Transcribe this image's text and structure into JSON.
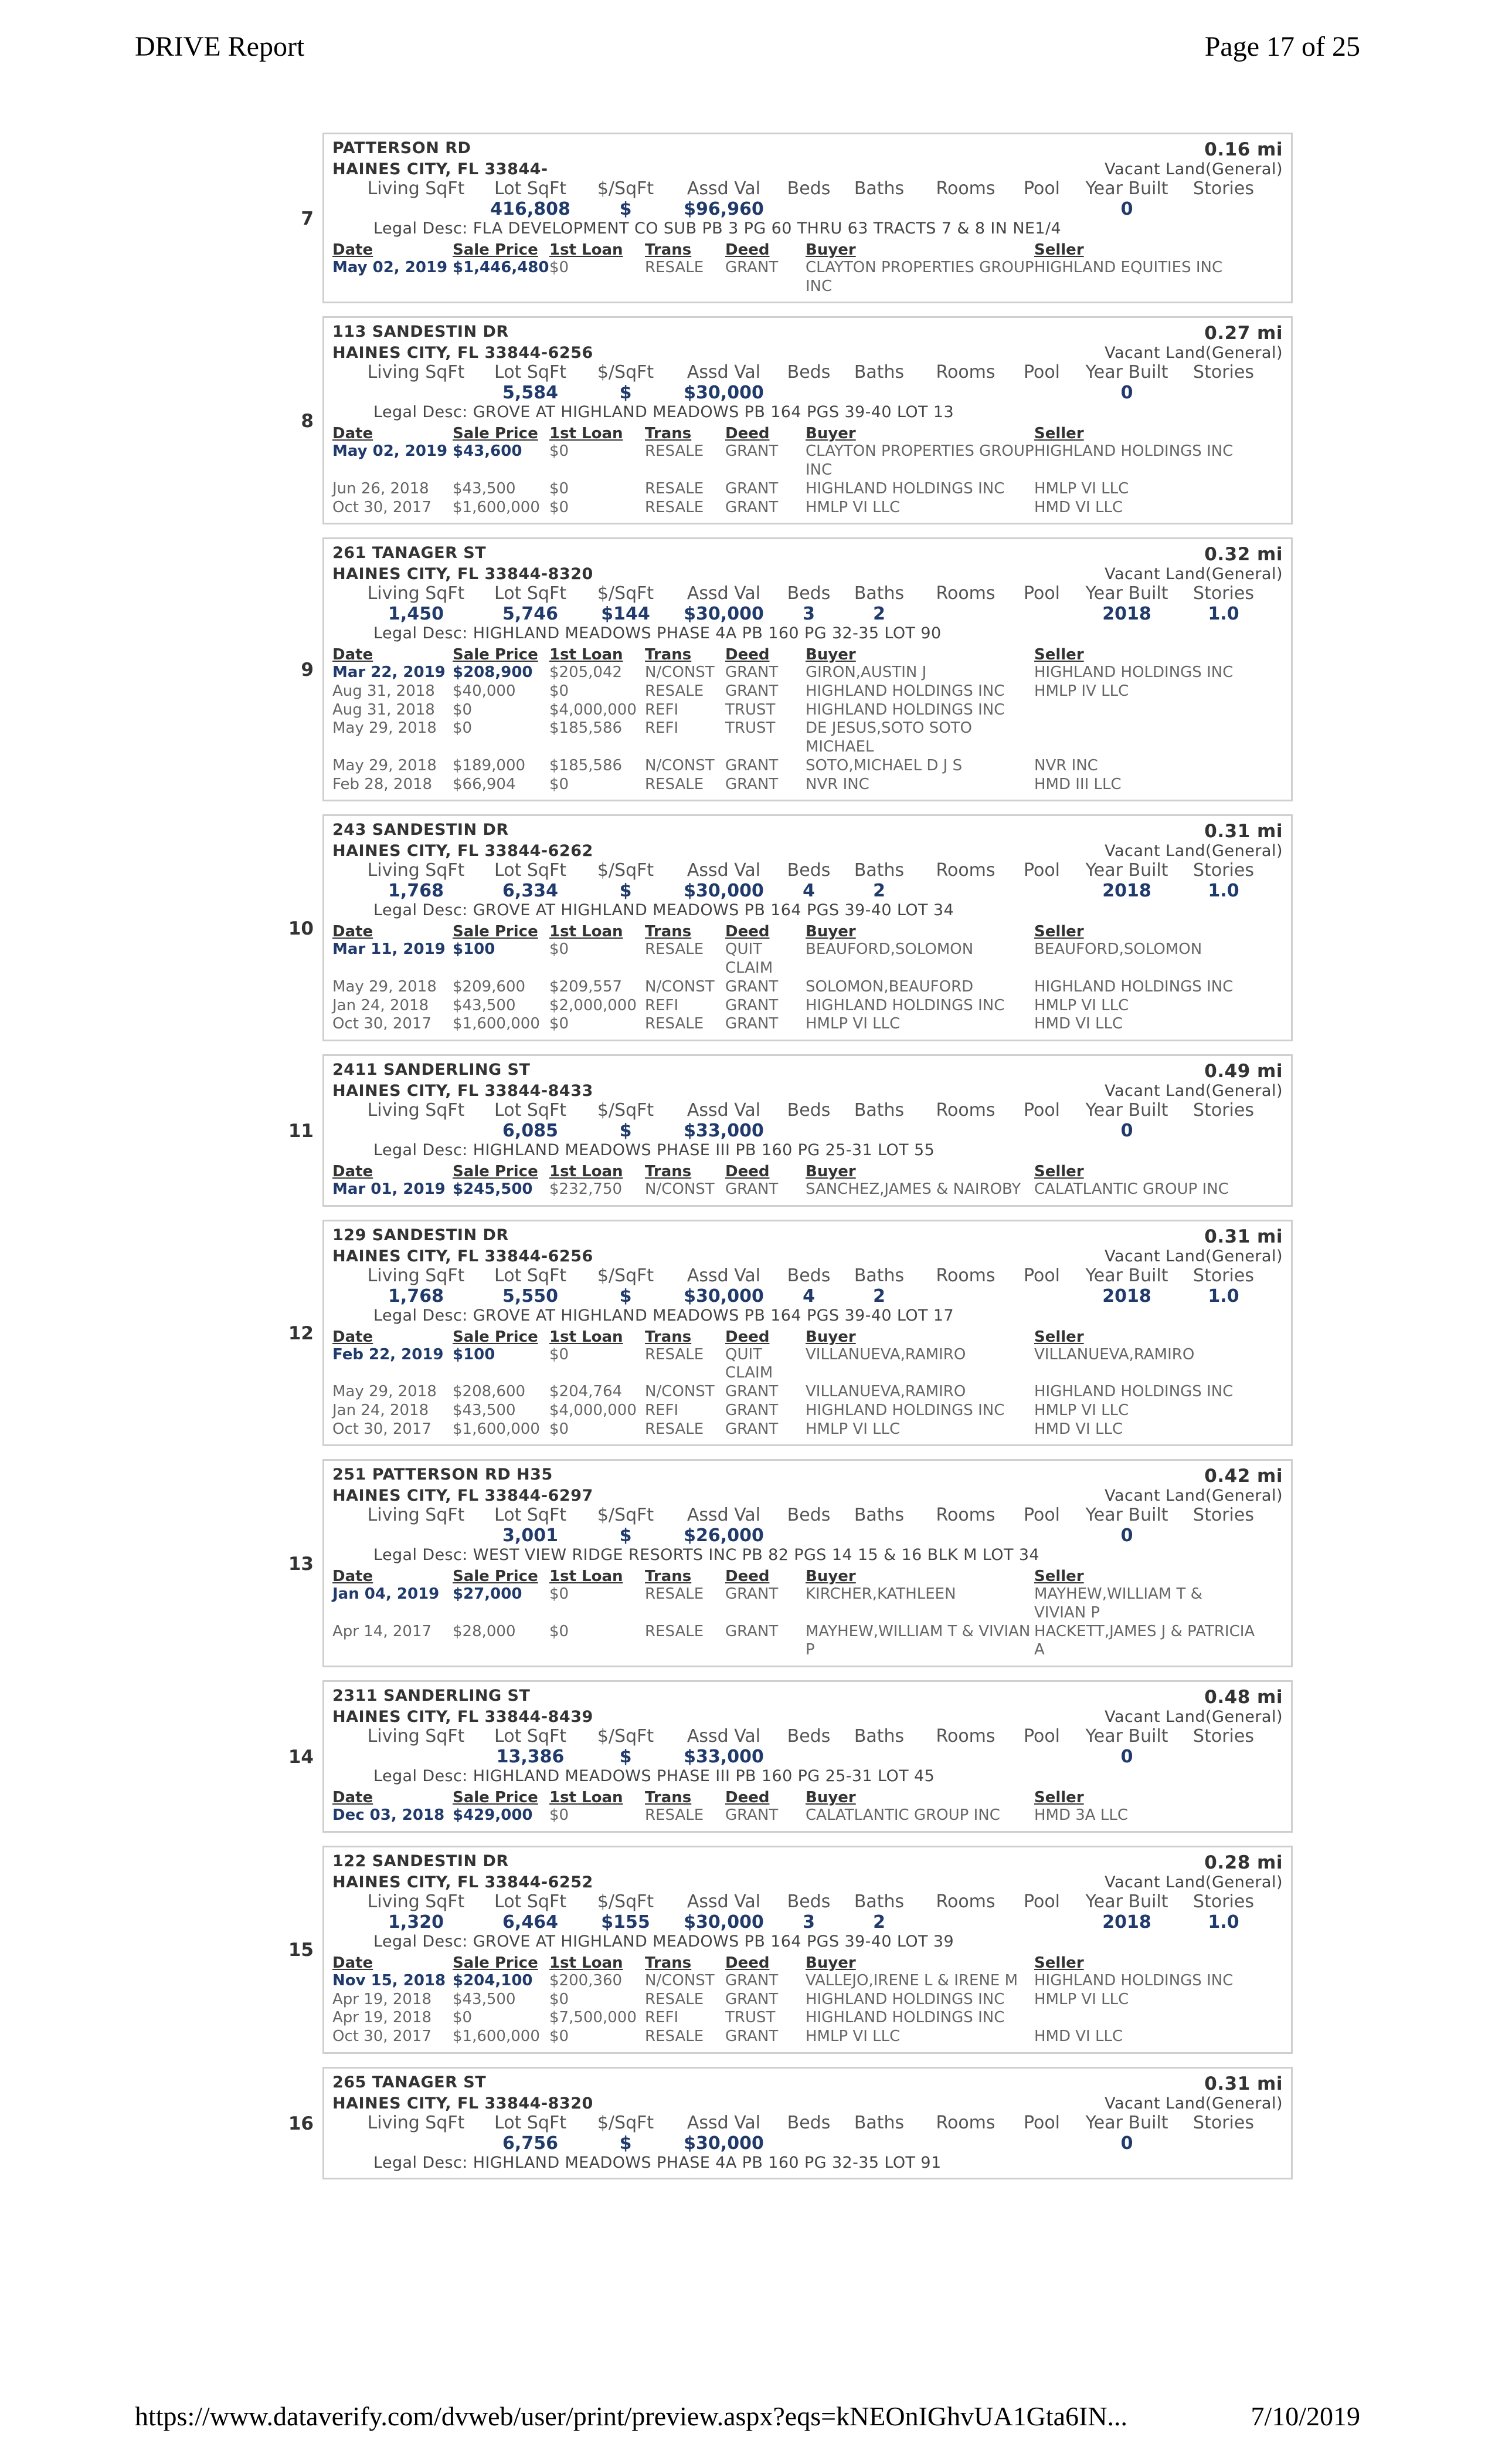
{
  "header": {
    "title": "DRIVE Report",
    "page": "Page 17 of 25"
  },
  "footer": {
    "url": "https://www.dataverify.com/dvweb/user/print/preview.aspx?eqs=kNEOnIGhvUA1Gta6IN...",
    "date": "7/10/2019"
  },
  "stat_labels": [
    "Living SqFt",
    "Lot SqFt",
    "$/SqFt",
    "Assd Val",
    "Beds",
    "Baths",
    "Rooms",
    "Pool",
    "Year Built",
    "Stories"
  ],
  "sale_headers": [
    "Date",
    "Sale Price",
    "1st Loan",
    "Trans",
    "Deed",
    "Buyer",
    "Seller"
  ],
  "properties": [
    {
      "index": "7",
      "address": "PATTERSON RD",
      "city": "HAINES CITY, FL 33844-",
      "distance": "0.16 mi",
      "type": "Vacant Land(General)",
      "stats": [
        "",
        "416,808",
        "$",
        "$96,960",
        "",
        "",
        "",
        "",
        "0",
        ""
      ],
      "legal": "Legal Desc: FLA DEVELOPMENT CO SUB PB 3 PG 60 THRU 63 TRACTS 7 & 8 IN NE1/4",
      "sales": [
        [
          "May 02, 2019",
          "$1,446,480",
          "$0",
          "RESALE",
          "GRANT",
          "CLAYTON PROPERTIES GROUP INC",
          "HIGHLAND EQUITIES INC"
        ]
      ]
    },
    {
      "index": "8",
      "address": "113 SANDESTIN DR",
      "city": "HAINES CITY, FL 33844-6256",
      "distance": "0.27 mi",
      "type": "Vacant Land(General)",
      "stats": [
        "",
        "5,584",
        "$",
        "$30,000",
        "",
        "",
        "",
        "",
        "0",
        ""
      ],
      "legal": "Legal Desc: GROVE AT HIGHLAND MEADOWS PB 164 PGS 39-40 LOT 13",
      "sales": [
        [
          "May 02, 2019",
          "$43,600",
          "$0",
          "RESALE",
          "GRANT",
          "CLAYTON PROPERTIES GROUP INC",
          "HIGHLAND HOLDINGS INC"
        ],
        [
          "Jun 26, 2018",
          "$43,500",
          "$0",
          "RESALE",
          "GRANT",
          "HIGHLAND HOLDINGS INC",
          "HMLP VI LLC"
        ],
        [
          "Oct 30, 2017",
          "$1,600,000",
          "$0",
          "RESALE",
          "GRANT",
          "HMLP VI LLC",
          "HMD VI LLC"
        ]
      ]
    },
    {
      "index": "9",
      "address": "261 TANAGER ST",
      "city": "HAINES CITY, FL 33844-8320",
      "distance": "0.32 mi",
      "type": "Vacant Land(General)",
      "stats": [
        "1,450",
        "5,746",
        "$144",
        "$30,000",
        "3",
        "2",
        "",
        "",
        "2018",
        "1.0"
      ],
      "legal": "Legal Desc: HIGHLAND MEADOWS PHASE 4A PB 160 PG 32-35 LOT 90",
      "sales": [
        [
          "Mar 22, 2019",
          "$208,900",
          "$205,042",
          "N/CONST",
          "GRANT",
          "GIRON,AUSTIN J",
          "HIGHLAND HOLDINGS INC"
        ],
        [
          "Aug 31, 2018",
          "$40,000",
          "$0",
          "RESALE",
          "GRANT",
          "HIGHLAND HOLDINGS INC",
          "HMLP IV LLC"
        ],
        [
          "Aug 31, 2018",
          "$0",
          "$4,000,000",
          "REFI",
          "TRUST",
          "HIGHLAND HOLDINGS INC",
          ""
        ],
        [
          "May 29, 2018",
          "$0",
          "$185,586",
          "REFI",
          "TRUST",
          "DE JESUS,SOTO SOTO MICHAEL",
          ""
        ],
        [
          "May 29, 2018",
          "$189,000",
          "$185,586",
          "N/CONST",
          "GRANT",
          "SOTO,MICHAEL D J S",
          "NVR INC"
        ],
        [
          "Feb 28, 2018",
          "$66,904",
          "$0",
          "RESALE",
          "GRANT",
          "NVR INC",
          "HMD III LLC"
        ]
      ]
    },
    {
      "index": "10",
      "address": "243 SANDESTIN DR",
      "city": "HAINES CITY, FL 33844-6262",
      "distance": "0.31 mi",
      "type": "Vacant Land(General)",
      "stats": [
        "1,768",
        "6,334",
        "$",
        "$30,000",
        "4",
        "2",
        "",
        "",
        "2018",
        "1.0"
      ],
      "legal": "Legal Desc: GROVE AT HIGHLAND MEADOWS PB 164 PGS 39-40 LOT 34",
      "sales": [
        [
          "Mar 11, 2019",
          "$100",
          "$0",
          "RESALE",
          "QUIT CLAIM",
          "BEAUFORD,SOLOMON",
          "BEAUFORD,SOLOMON"
        ],
        [
          "May 29, 2018",
          "$209,600",
          "$209,557",
          "N/CONST",
          "GRANT",
          "SOLOMON,BEAUFORD",
          "HIGHLAND HOLDINGS INC"
        ],
        [
          "Jan 24, 2018",
          "$43,500",
          "$2,000,000",
          "REFI",
          "GRANT",
          "HIGHLAND HOLDINGS INC",
          "HMLP VI LLC"
        ],
        [
          "Oct 30, 2017",
          "$1,600,000",
          "$0",
          "RESALE",
          "GRANT",
          "HMLP VI LLC",
          "HMD VI LLC"
        ]
      ]
    },
    {
      "index": "11",
      "address": "2411 SANDERLING ST",
      "city": "HAINES CITY, FL 33844-8433",
      "distance": "0.49 mi",
      "type": "Vacant Land(General)",
      "stats": [
        "",
        "6,085",
        "$",
        "$33,000",
        "",
        "",
        "",
        "",
        "0",
        ""
      ],
      "legal": "Legal Desc: HIGHLAND MEADOWS PHASE III PB 160 PG 25-31 LOT 55",
      "sales": [
        [
          "Mar 01, 2019",
          "$245,500",
          "$232,750",
          "N/CONST",
          "GRANT",
          "SANCHEZ,JAMES & NAIROBY",
          "CALATLANTIC GROUP INC"
        ]
      ]
    },
    {
      "index": "12",
      "address": "129 SANDESTIN DR",
      "city": "HAINES CITY, FL 33844-6256",
      "distance": "0.31 mi",
      "type": "Vacant Land(General)",
      "stats": [
        "1,768",
        "5,550",
        "$",
        "$30,000",
        "4",
        "2",
        "",
        "",
        "2018",
        "1.0"
      ],
      "legal": "Legal Desc: GROVE AT HIGHLAND MEADOWS PB 164 PGS 39-40 LOT 17",
      "sales": [
        [
          "Feb 22, 2019",
          "$100",
          "$0",
          "RESALE",
          "QUIT CLAIM",
          "VILLANUEVA,RAMIRO",
          "VILLANUEVA,RAMIRO"
        ],
        [
          "May 29, 2018",
          "$208,600",
          "$204,764",
          "N/CONST",
          "GRANT",
          "VILLANUEVA,RAMIRO",
          "HIGHLAND HOLDINGS INC"
        ],
        [
          "Jan 24, 2018",
          "$43,500",
          "$4,000,000",
          "REFI",
          "GRANT",
          "HIGHLAND HOLDINGS INC",
          "HMLP VI LLC"
        ],
        [
          "Oct 30, 2017",
          "$1,600,000",
          "$0",
          "RESALE",
          "GRANT",
          "HMLP VI LLC",
          "HMD VI LLC"
        ]
      ]
    },
    {
      "index": "13",
      "address": "251 PATTERSON RD H35",
      "city": "HAINES CITY, FL 33844-6297",
      "distance": "0.42 mi",
      "type": "Vacant Land(General)",
      "stats": [
        "",
        "3,001",
        "$",
        "$26,000",
        "",
        "",
        "",
        "",
        "0",
        ""
      ],
      "legal": "Legal Desc: WEST VIEW RIDGE RESORTS INC PB 82 PGS 14 15 & 16 BLK M LOT 34",
      "sales": [
        [
          "Jan 04, 2019",
          "$27,000",
          "$0",
          "RESALE",
          "GRANT",
          "KIRCHER,KATHLEEN",
          "MAYHEW,WILLIAM T & VIVIAN P"
        ],
        [
          "Apr 14, 2017",
          "$28,000",
          "$0",
          "RESALE",
          "GRANT",
          "MAYHEW,WILLIAM T & VIVIAN P",
          "HACKETT,JAMES J & PATRICIA A"
        ]
      ]
    },
    {
      "index": "14",
      "address": "2311 SANDERLING ST",
      "city": "HAINES CITY, FL 33844-8439",
      "distance": "0.48 mi",
      "type": "Vacant Land(General)",
      "stats": [
        "",
        "13,386",
        "$",
        "$33,000",
        "",
        "",
        "",
        "",
        "0",
        ""
      ],
      "legal": "Legal Desc: HIGHLAND MEADOWS PHASE III PB 160 PG 25-31 LOT 45",
      "sales": [
        [
          "Dec 03, 2018",
          "$429,000",
          "$0",
          "RESALE",
          "GRANT",
          "CALATLANTIC GROUP INC",
          "HMD 3A LLC"
        ]
      ]
    },
    {
      "index": "15",
      "address": "122 SANDESTIN DR",
      "city": "HAINES CITY, FL 33844-6252",
      "distance": "0.28 mi",
      "type": "Vacant Land(General)",
      "stats": [
        "1,320",
        "6,464",
        "$155",
        "$30,000",
        "3",
        "2",
        "",
        "",
        "2018",
        "1.0"
      ],
      "legal": "Legal Desc: GROVE AT HIGHLAND MEADOWS PB 164 PGS 39-40 LOT 39",
      "sales": [
        [
          "Nov 15, 2018",
          "$204,100",
          "$200,360",
          "N/CONST",
          "GRANT",
          "VALLEJO,IRENE L & IRENE M",
          "HIGHLAND HOLDINGS INC"
        ],
        [
          "Apr 19, 2018",
          "$43,500",
          "$0",
          "RESALE",
          "GRANT",
          "HIGHLAND HOLDINGS INC",
          "HMLP VI LLC"
        ],
        [
          "Apr 19, 2018",
          "$0",
          "$7,500,000",
          "REFI",
          "TRUST",
          "HIGHLAND HOLDINGS INC",
          ""
        ],
        [
          "Oct 30, 2017",
          "$1,600,000",
          "$0",
          "RESALE",
          "GRANT",
          "HMLP VI LLC",
          "HMD VI LLC"
        ]
      ]
    },
    {
      "index": "16",
      "address": "265 TANAGER ST",
      "city": "HAINES CITY, FL 33844-8320",
      "distance": "0.31 mi",
      "type": "Vacant Land(General)",
      "stats": [
        "",
        "6,756",
        "$",
        "$30,000",
        "",
        "",
        "",
        "",
        "0",
        ""
      ],
      "legal": "Legal Desc: HIGHLAND MEADOWS PHASE 4A PB 160 PG 32-35 LOT 91",
      "sales": []
    }
  ]
}
